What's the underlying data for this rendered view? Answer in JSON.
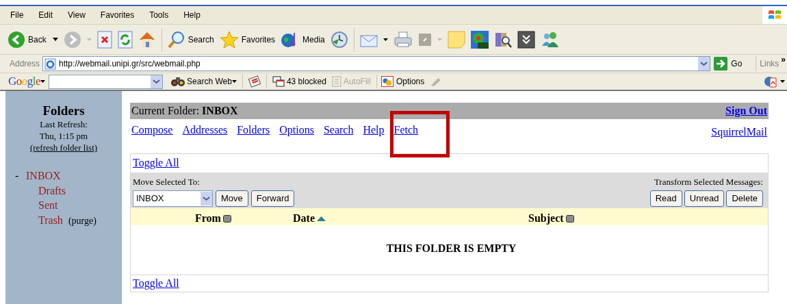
{
  "menu_bar": [
    "File",
    "Edit",
    "View",
    "Favorites",
    "Tools",
    "Help"
  ],
  "toolbar": {
    "back": "Back",
    "search": "Search",
    "favorites": "Favorites",
    "media": "Media"
  },
  "address_bar": {
    "label": "Address",
    "url": "http://webmail.unipi.gr/src/webmail.php",
    "go": "Go",
    "links": "Links",
    "chevron": "»"
  },
  "google_bar": {
    "logo": "Google",
    "search_web": "Search Web",
    "blocked": "43 blocked",
    "autofill": {
      "label": "AutoFill",
      "disabled": true
    },
    "options": "Options"
  },
  "sidebar": {
    "title": "Folders",
    "last_refresh": "Last Refresh:",
    "time": "Thu, 1:15 pm",
    "refresh_link": "(refresh folder list)",
    "folders": [
      {
        "name": "INBOX",
        "toggle": "-",
        "children": [
          {
            "name": "Drafts"
          },
          {
            "name": "Sent"
          },
          {
            "name": "Trash",
            "action": "(purge)"
          }
        ]
      }
    ]
  },
  "main": {
    "current_folder_label": "Current Folder:",
    "current_folder": "INBOX",
    "sign_out": "Sign Out",
    "nav_links": [
      "Compose",
      "Addresses",
      "Folders",
      "Options",
      "Search",
      "Help",
      "Fetch"
    ],
    "brand_link": "SquirrelMail",
    "toggle_all": "Toggle All",
    "move_label": "Move Selected To:",
    "move_select": "INBOX",
    "move_buttons": [
      "Move",
      "Forward"
    ],
    "transform_label": "Transform Selected Messages:",
    "transform_buttons": [
      "Read",
      "Unread",
      "Delete"
    ],
    "columns": [
      {
        "label": "From",
        "sorted": false
      },
      {
        "label": "Date",
        "sorted": true
      },
      {
        "label": "Subject",
        "sorted": false
      }
    ],
    "empty_message": "THIS FOLDER IS EMPTY",
    "toggle_all_bottom": "Toggle All"
  }
}
